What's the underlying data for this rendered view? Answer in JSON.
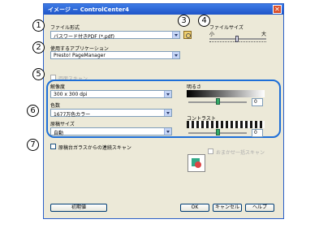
{
  "window": {
    "title": "イメージ － ControlCenter4",
    "close_glyph": "✕"
  },
  "callouts": [
    "1",
    "2",
    "3",
    "4",
    "5",
    "6",
    "7"
  ],
  "file_format": {
    "label": "ファイル形式",
    "value": "パスワード付きPDF (*.pdf)"
  },
  "file_size": {
    "label": "ファイルサイズ",
    "small": "小",
    "large": "大"
  },
  "target_app": {
    "label": "使用するアプリケーション",
    "value": "Presto! PageManager"
  },
  "duplex": {
    "label": "両面スキャン"
  },
  "resolution": {
    "label": "解像度",
    "value": "300 x 300 dpi"
  },
  "color": {
    "label": "色数",
    "value": "1677万色カラー"
  },
  "doc_size": {
    "label": "原稿サイズ",
    "value": "自動"
  },
  "brightness": {
    "label": "明るさ",
    "value": "0"
  },
  "contrast": {
    "label": "コントラスト",
    "value": "0"
  },
  "continuous_scan": {
    "label": "原稿台ガラスからの連続スキャン"
  },
  "skip_dialog": {
    "label": "おまかせ一括スキャン"
  },
  "buttons": {
    "defaults": "初期値",
    "ok": "OK",
    "cancel": "キャンセル",
    "help": "ヘルプ"
  },
  "icons": {
    "settings": "settings-icon",
    "preview": "scan-preview-icon"
  }
}
